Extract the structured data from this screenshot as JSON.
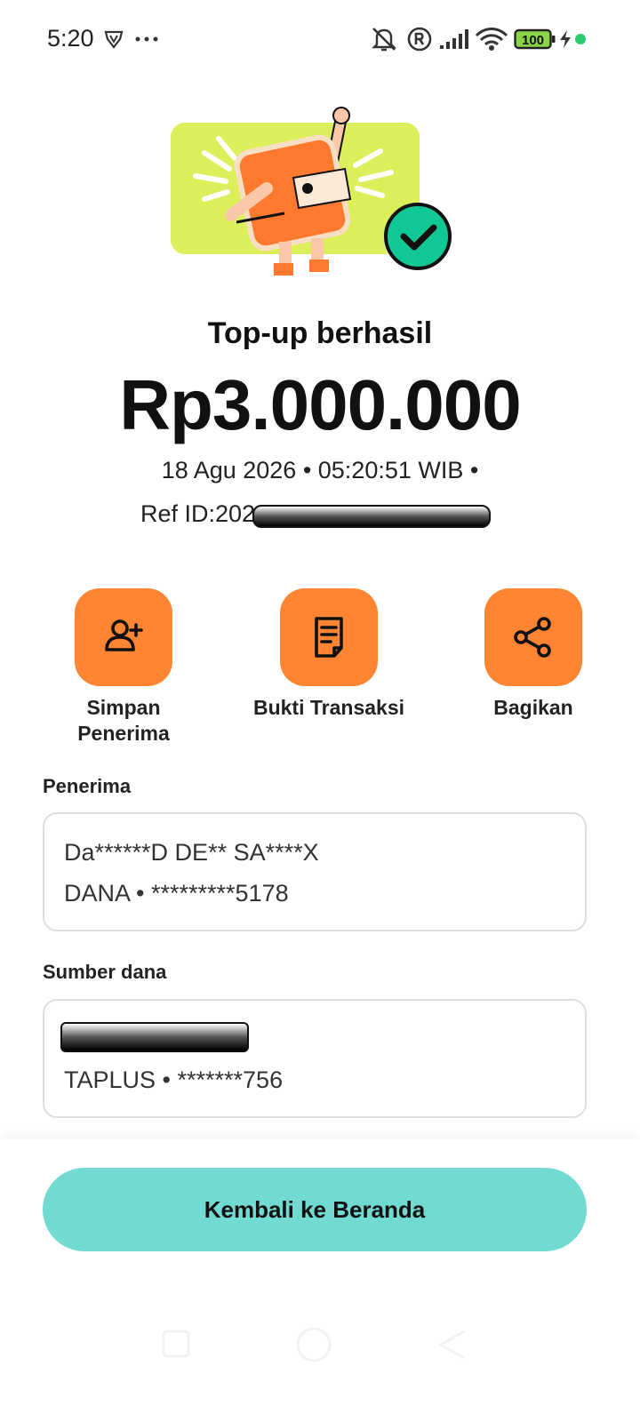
{
  "status_bar": {
    "time": "5:20",
    "battery_level": "100",
    "icons": [
      "vpn-shield-icon",
      "more-dots-icon",
      "mute-bell-icon",
      "registered-icon",
      "signal-icon",
      "wifi-icon",
      "battery-icon",
      "charging-icon",
      "dot-indicator-icon"
    ]
  },
  "result": {
    "title": "Top-up berhasil",
    "amount": "Rp3.000.000",
    "datetime": "18 Agu 2026 • 05:20:51 WIB •",
    "ref_prefix": "Ref ID:202"
  },
  "actions": [
    {
      "label": "Simpan Penerima",
      "icon": "add-user-icon"
    },
    {
      "label": "Bukti Transaksi",
      "icon": "receipt-icon"
    },
    {
      "label": "Bagikan",
      "icon": "share-icon"
    }
  ],
  "recipient": {
    "label": "Penerima",
    "name": "Da******D DE** SA****X",
    "account": "DANA • *********5178"
  },
  "source": {
    "label": "Sumber dana",
    "account": "TAPLUS • *******756"
  },
  "footer": {
    "home_button": "Kembali ke Beranda"
  },
  "colors": {
    "accent_orange": "#ff8533",
    "button_teal": "#72dbd1",
    "illustration_bg": "#dcef5a",
    "success_green": "#10c896"
  }
}
